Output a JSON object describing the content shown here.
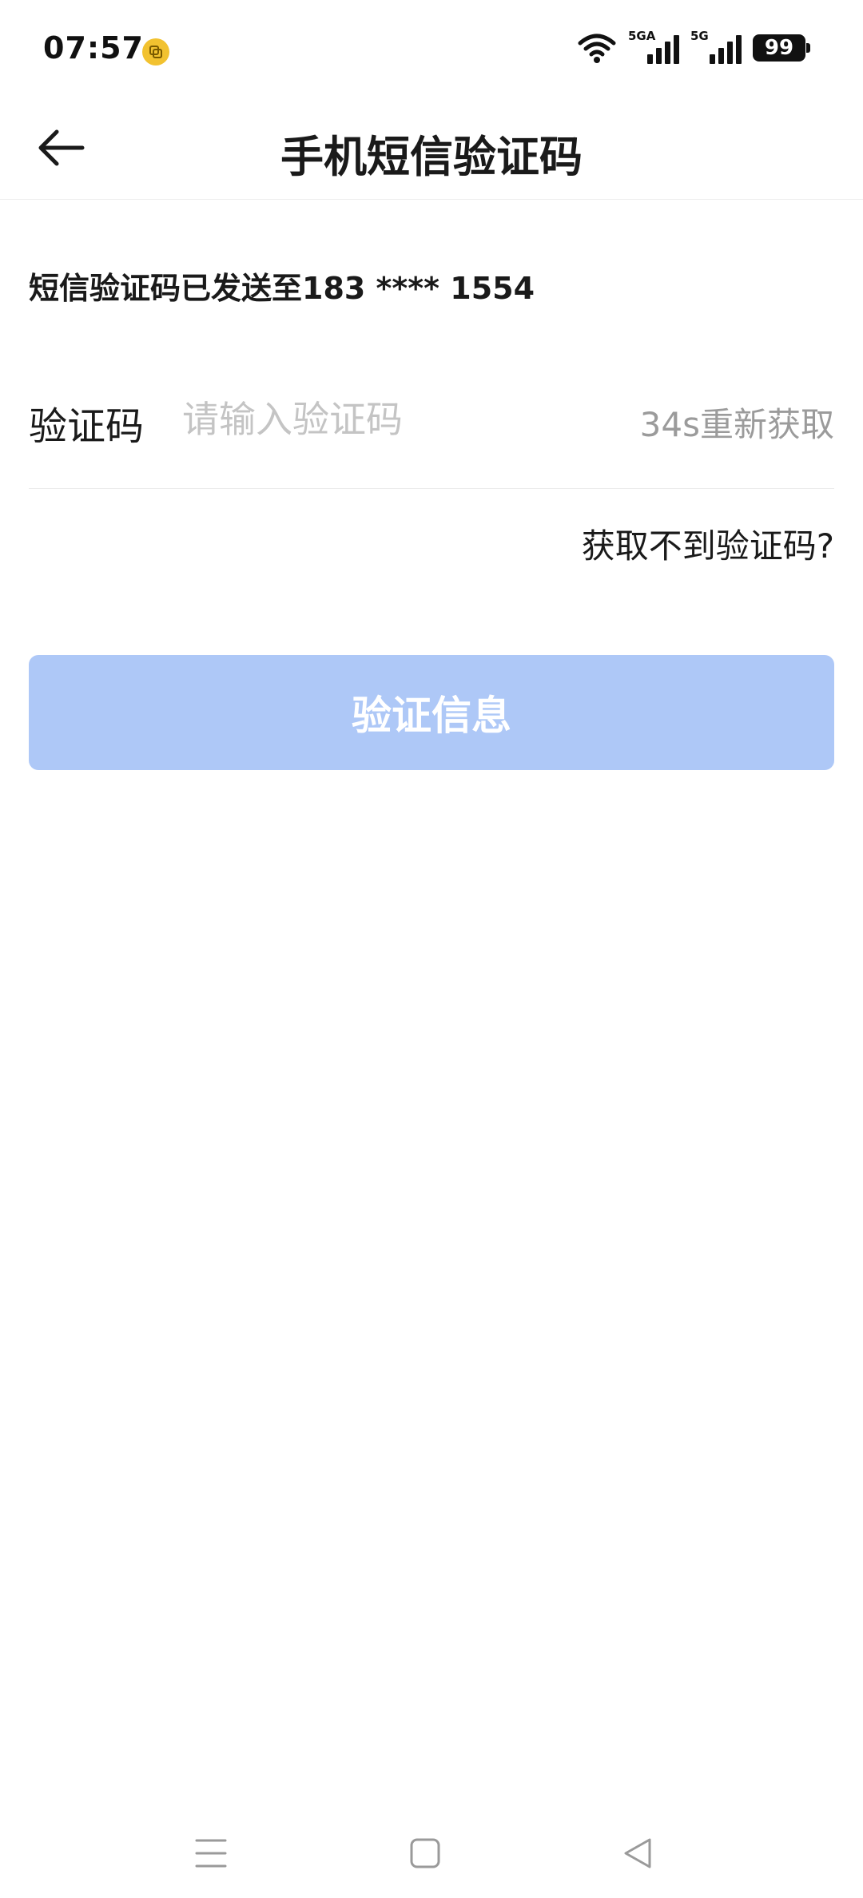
{
  "status_bar": {
    "time": "07:57",
    "signal_1_label": "5GA",
    "signal_2_label": "5G",
    "battery": "99",
    "icons": [
      "app-notification-icon",
      "wifi-icon",
      "signal-icon",
      "battery-icon"
    ]
  },
  "header": {
    "title": "手机短信验证码",
    "back_icon": "arrow-left-icon"
  },
  "content": {
    "sent_notice": "短信验证码已发送至183 **** 1554",
    "code_label": "验证码",
    "code_placeholder": "请输入验证码",
    "code_value": "",
    "resend_label": "34s重新获取",
    "help_link": "获取不到验证码?",
    "verify_button": "验证信息"
  },
  "nav_bar": {
    "icons": [
      "menu-icon",
      "home-icon",
      "back-triangle-icon"
    ]
  },
  "colors": {
    "primary_disabled": "#aec8f7",
    "text_primary": "#1a1a1a",
    "text_secondary": "#9b9b9b",
    "placeholder": "#c4c4c4",
    "app_icon": "#f2c230"
  }
}
